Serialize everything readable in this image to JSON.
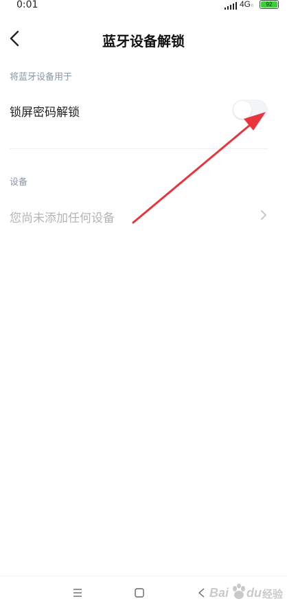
{
  "status_bar": {
    "time": "0:01",
    "network": "4G",
    "network_sub": "ll",
    "battery": "92"
  },
  "header": {
    "title": "蓝牙设备解锁"
  },
  "sections": {
    "usage": {
      "label": "将蓝牙设备用于",
      "item": {
        "label": "锁屏密码解锁",
        "toggle_on": false
      }
    },
    "devices": {
      "label": "设备",
      "empty_text": "您尚未添加任何设备"
    }
  },
  "watermark": {
    "text_bai": "Bai",
    "text_du": "du",
    "text_jingyan": "经验"
  },
  "colors": {
    "annotation_arrow": "#e8343a",
    "section_label": "#8a96a8",
    "toggle_off": "#f3f4f7"
  },
  "icons": [
    "back-arrow-icon",
    "chevron-right-icon",
    "menu-icon",
    "home-square-icon",
    "back-triangle-icon",
    "signal-icon",
    "battery-icon",
    "baidu-paw-icon"
  ]
}
